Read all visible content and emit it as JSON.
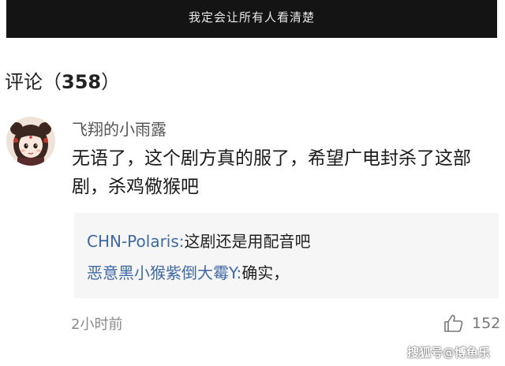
{
  "video": {
    "subtitle": "我定会让所有人看清楚"
  },
  "comments_header": {
    "label": "评论",
    "open": "（",
    "count": "358",
    "close": "）"
  },
  "comment": {
    "username": "飞翔的小雨露",
    "text": "无语了，这个剧方真的服了，希望广电封杀了这部剧，杀鸡儆猴吧",
    "replies": [
      {
        "user": "CHN-Polaris:",
        "text": "这剧还是用配音吧"
      },
      {
        "user": "恶意黑小猴紫倒大霉Y:",
        "text": "确实，"
      }
    ],
    "time": "2小时前",
    "likes": "152"
  },
  "watermark": "搜狐号@博鱼乐"
}
